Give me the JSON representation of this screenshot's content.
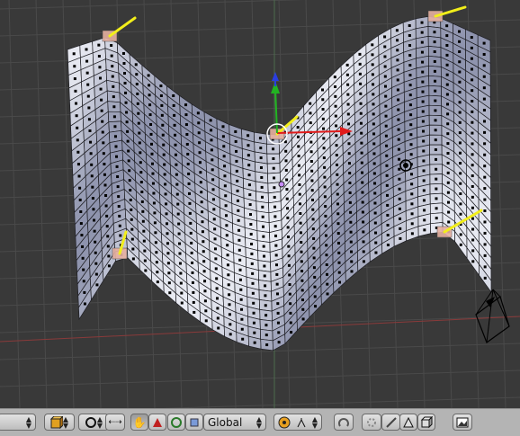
{
  "header": {
    "orientation_label": "Global"
  },
  "icons": {
    "object_mode": "object-mode-icon",
    "draw_type": "solid-draw-icon",
    "grab": "hand-grab-icon",
    "rotate": "rotate-manipulator-icon",
    "scale": "scale-manipulator-icon",
    "pivot": "pivot-point-icon",
    "proportional": "proportional-edit-icon",
    "snap": "snap-icon",
    "select_vertex": "vertex-select-icon",
    "select_edge": "edge-select-icon",
    "select_face": "face-select-icon",
    "occlude": "occlude-geometry-icon",
    "render": "render-icon"
  },
  "colors": {
    "viewport_bg": "#393939",
    "header_bg": "#b4b4b4",
    "mesh_face_light": "#e8eaf2",
    "mesh_face_dark": "#8e93ad",
    "hook_yellow": "#f2ee1a",
    "axis_red": "#e01b1b",
    "axis_green": "#22b422",
    "axis_blue": "#2a3ee0"
  }
}
